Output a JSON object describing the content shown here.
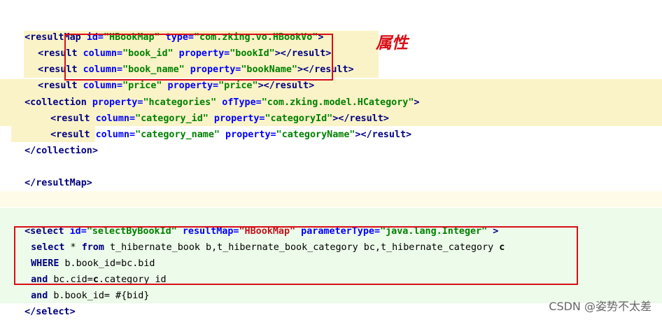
{
  "highlight_colors": {
    "yellow": "#faf3c7",
    "green": "#edfbea",
    "pale": "#fefbe8"
  },
  "annotation": "属性",
  "watermark": "CSDN @姿势不太差",
  "code": {
    "l1": {
      "open": "<resultMap ",
      "a1": "id=",
      "v1": "\"HBookMap\"",
      "a2": " type=",
      "v2": "\"com.zking.vo.HBookVo\"",
      "close": ">"
    },
    "l2": {
      "open": "<result ",
      "a1": "column=",
      "v1": "\"book_id\"",
      "a2": " property=",
      "v2": "\"bookId\"",
      "close": "></result>"
    },
    "l3": {
      "open": "<result ",
      "a1": "column=",
      "v1": "\"book_name\"",
      "a2": " property=",
      "v2": "\"bookName\"",
      "close": "></result>"
    },
    "l4": {
      "open": "<result ",
      "a1": "column=",
      "v1": "\"price\"",
      "a2": " property=",
      "v2": "\"price\"",
      "close": "></result>"
    },
    "l5": {
      "open": "<collection ",
      "a1": "property=",
      "v1": "\"hcategories\"",
      "a2": " ofType=",
      "v2": "\"com.zking.model.HCategory\"",
      "close": ">"
    },
    "l6": {
      "open": "<result ",
      "a1": "column=",
      "v1": "\"category_id\"",
      "a2": " property=",
      "v2": "\"categoryId\"",
      "close": "></result>"
    },
    "l7": {
      "open": "<result ",
      "a1": "column=",
      "v1": "\"category_name\"",
      "a2": " property=",
      "v2": "\"categoryName\"",
      "close": "></result>"
    },
    "l8": {
      "text": "</collection>"
    },
    "l9": {
      "text": "</resultMap>"
    },
    "l10": {
      "open": "<select ",
      "a1": "id=",
      "v1": "\"selectByBookId\"",
      "a2": " resultMap=",
      "v2": "\"HBookMap\"",
      "a3": " parameterType=",
      "v3": "\"java.lang.Integer\"",
      "close": " >"
    },
    "l11": {
      "kw1": "select",
      "t1": " * ",
      "kw2": "from",
      "t2": " t_hibernate_book b,t_hibernate_book_category bc,t_hibernate_category ",
      "kw3": "c"
    },
    "l12": {
      "kw1": "WHERE",
      "t1": " b.book_id=bc.bid"
    },
    "l13": {
      "kw1": "and",
      "t1": " bc.cid=",
      "kw2": "c",
      "t2": ".category_id"
    },
    "l14": {
      "kw1": "and",
      "t1": " b.book_id= #{bid}"
    },
    "l15": {
      "text": "</select>"
    }
  }
}
